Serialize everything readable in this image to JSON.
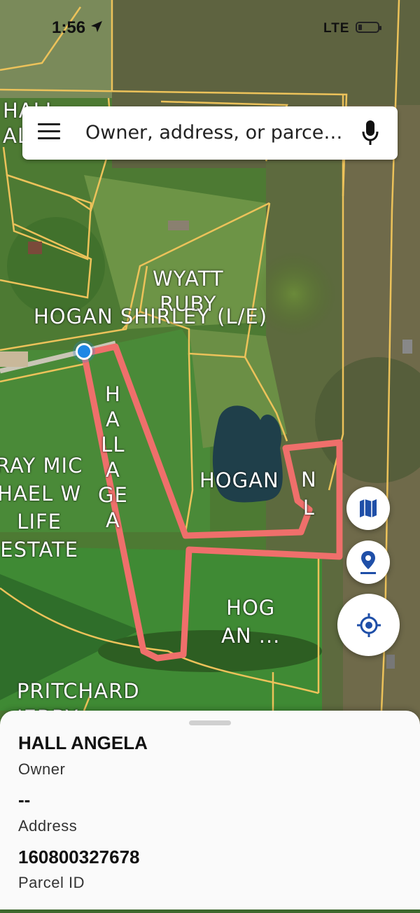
{
  "status_bar": {
    "time": "1:56",
    "network": "LTE"
  },
  "search": {
    "placeholder": "Owner, address, or parce…",
    "menu_icon": "menu-icon",
    "mic_icon": "microphone-icon"
  },
  "map": {
    "labels": {
      "hall_top": "HALL\nAL",
      "wyatt_ruby": "WYATT\nRUBY",
      "hogan_shirley": "HOGAN SHIRLEY (L/E)",
      "hall_angela_vertical": "H\nA\nLL\nA\nGE\nA",
      "hogan_center": "HOGAN",
      "nl": "N\nL",
      "ray_michael": "RAY MIC\nHAEL W\nLIFE\nESTATE",
      "hogan_bottom": "HOG\nAN ...",
      "pritchard": "PRITCHARD\nJERRY"
    },
    "colors": {
      "parcel_outline": "#ecc25a",
      "selected_parcel": "#ef6f6b",
      "location_dot": "#1e88e5"
    }
  },
  "map_controls": {
    "layers_icon": "map-layers-icon",
    "pin_icon": "location-pin-icon",
    "locate_icon": "my-location-icon"
  },
  "parcel": {
    "owner": "HALL ANGELA",
    "owner_label": "Owner",
    "address": "--",
    "address_label": "Address",
    "parcel_id": "160800327678",
    "parcel_id_label": "Parcel ID"
  }
}
